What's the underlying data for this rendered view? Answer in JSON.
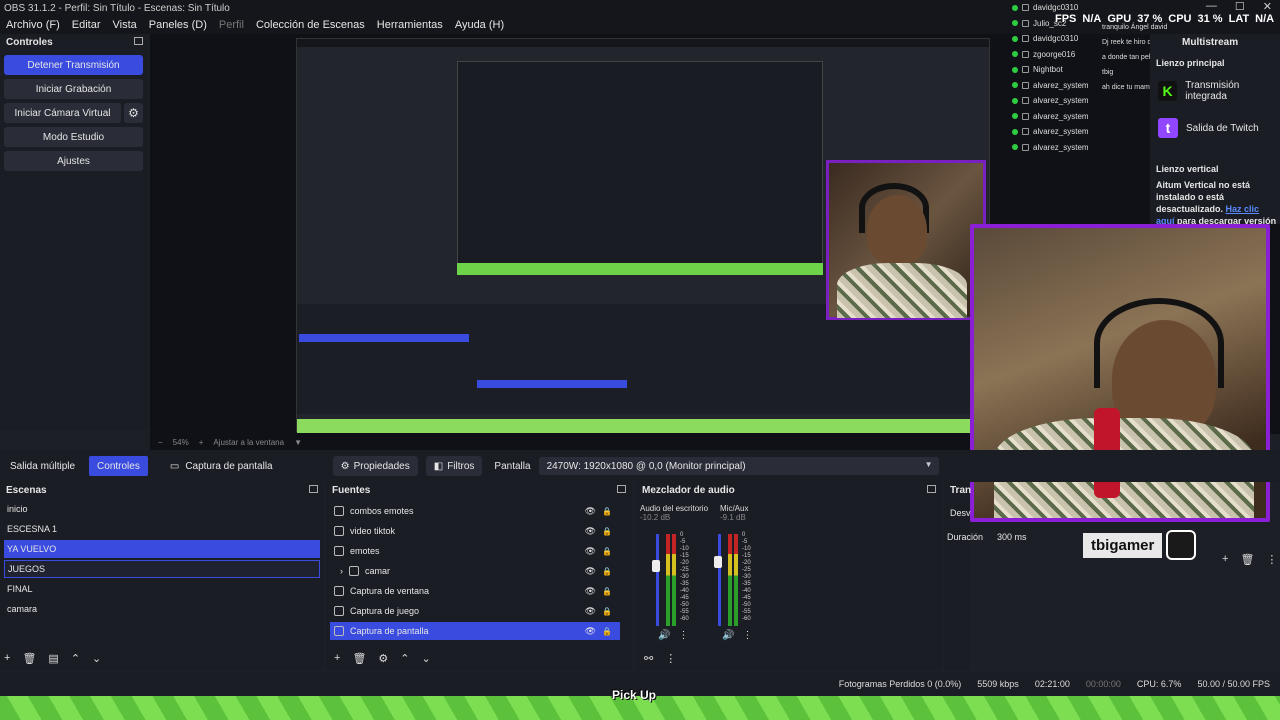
{
  "title_bar": {
    "text": "OBS 31.1.2 - Perfil: Sin Título - Escenas: Sin Título",
    "controls": [
      "—",
      "☐",
      "✕"
    ]
  },
  "menu": {
    "items": [
      "Archivo (F)",
      "Editar",
      "Vista",
      "Paneles (D)",
      "Perfil",
      "Colección de Escenas",
      "Herramientas",
      "Ayuda (H)"
    ]
  },
  "controls": {
    "title": "Controles",
    "buttons": [
      "Detener Transmisión",
      "Iniciar Grabación",
      "Iniciar Cámara Virtual",
      "Modo Estudio",
      "Ajustes"
    ]
  },
  "zoom": {
    "minus": "−",
    "value": "54%",
    "plus": "+",
    "fit": "Ajustar a la ventana"
  },
  "bottom_tabs": {
    "multi": "Salida múltiple",
    "controls": "Controles"
  },
  "source_bar": {
    "source_name": "Captura de pantalla",
    "properties": "Propiedades",
    "filters": "Filtros",
    "display_label": "Pantalla",
    "display_value": "2470W: 1920x1080 @ 0,0 (Monitor principal)"
  },
  "scenes": {
    "title": "Escenas",
    "items": [
      "inicio",
      "ESCESNA 1",
      "YA VUELVO",
      "JUEGOS",
      "FINAL",
      "camara"
    ]
  },
  "sources": {
    "title": "Fuentes",
    "items": [
      "combos emotes",
      "video tiktok",
      "emotes",
      "camar",
      "Captura de ventana",
      "Captura de juego",
      "Captura de pantalla"
    ]
  },
  "mixer": {
    "title": "Mezclador de audio",
    "channels": [
      {
        "name": "Audio del escritorio",
        "db": "-10.2 dB"
      },
      {
        "name": "Mic/Aux",
        "db": "-9.1 dB"
      }
    ],
    "scale": [
      "0",
      "-5",
      "-10",
      "-15",
      "-20",
      "-25",
      "-30",
      "-35",
      "-40",
      "-45",
      "-50",
      "-55",
      "-60"
    ]
  },
  "transitions": {
    "title": "Tran",
    "select": "Desv",
    "duration_label": "Duración",
    "duration_value": "300 ms"
  },
  "multistream": {
    "title": "Multistream",
    "section_main": "Lienzo principal",
    "services": [
      "Transmisión integrada",
      "Salida de Twitch"
    ],
    "section_vertical": "Lienzo vertical",
    "vertical_msg": "Aitum Vertical no está instalado o está desactualizado.",
    "link": "Haz clic aquí",
    "link_rest": " para descargar",
    "tail": "versión"
  },
  "overlay_stats": {
    "fps_label": "FPS",
    "fps_value": "N/A",
    "gpu_label": "GPU",
    "gpu_value": "37 %",
    "cpu_label": "CPU",
    "cpu_value": "31 %",
    "lat_label": "LAT",
    "lat_value": "N/A"
  },
  "chat": {
    "users": [
      "davidgc0310",
      "Julio_sc2",
      "davidgc0310",
      "zgoorge016",
      "Nightbot",
      "alvarez_system",
      "alvarez_system",
      "alvarez_system",
      "alvarez_system",
      "alvarez_system"
    ],
    "messages": [
      "tranquilo Ángel david",
      "Dj reek te hiro detuvio",
      "a donde tan pelnado mi tbig",
      "ah dice tu mam"
    ]
  },
  "overlay_name": "tbigamer",
  "pickup": "Pick Up",
  "status": {
    "dropped": "Fotogramas Perdidos 0 (0.0%)",
    "bitrate": "5509 kbps",
    "stream_time": "02:21:00",
    "rec_time": "00:00:00",
    "cpu": "CPU: 6.7%",
    "fps": "50.00 / 50.00 FPS"
  },
  "colors": {
    "accent": "#3a4be0",
    "frame": "#8a1fd6",
    "bg": "#1b1d24"
  }
}
